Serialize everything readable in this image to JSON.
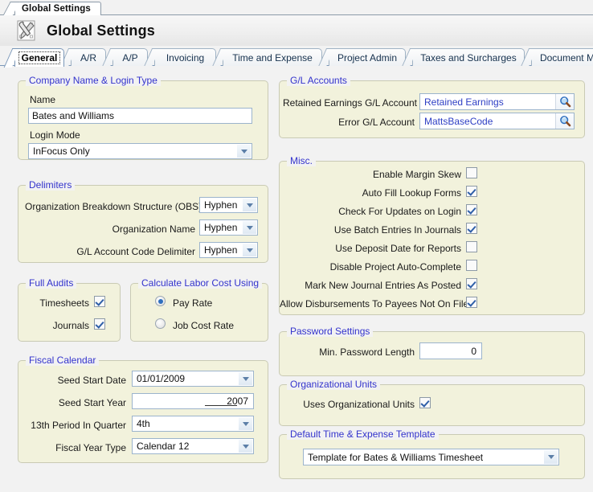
{
  "window": {
    "tab_label": "Global Settings"
  },
  "header": {
    "title": "Global Settings",
    "icon": "wrench-screwdriver-icon"
  },
  "tabs": [
    {
      "label": "General",
      "selected": true
    },
    {
      "label": "A/R",
      "selected": false
    },
    {
      "label": "A/P",
      "selected": false
    },
    {
      "label": "Invoicing",
      "selected": false
    },
    {
      "label": "Time and Expense",
      "selected": false
    },
    {
      "label": "Project Admin",
      "selected": false
    },
    {
      "label": "Taxes and Surcharges",
      "selected": false
    },
    {
      "label": "Document Management",
      "selected": false
    }
  ],
  "company_panel": {
    "legend": "Company Name & Login Type",
    "name_label": "Name",
    "name_value": "Bates and Williams",
    "login_mode_label": "Login Mode",
    "login_mode_value": "InFocus Only"
  },
  "delimiters_panel": {
    "legend": "Delimiters",
    "rows": [
      {
        "label": "Organization Breakdown Structure (OBS)",
        "value": "Hyphen"
      },
      {
        "label": "Organization Name",
        "value": "Hyphen"
      },
      {
        "label": "G/L Account Code Delimiter",
        "value": "Hyphen"
      }
    ]
  },
  "full_audits_panel": {
    "legend": "Full Audits",
    "rows": [
      {
        "label": "Timesheets",
        "checked": true
      },
      {
        "label": "Journals",
        "checked": true
      }
    ]
  },
  "labor_cost_panel": {
    "legend": "Calculate Labor Cost Using",
    "options": [
      {
        "label": "Pay Rate",
        "selected": true
      },
      {
        "label": "Job Cost Rate",
        "selected": false
      }
    ]
  },
  "fiscal_panel": {
    "legend": "Fiscal Calendar",
    "seed_start_date_label": "Seed Start Date",
    "seed_start_date_value": "01/01/2009",
    "seed_start_year_label": "Seed Start Year",
    "seed_start_year_value": "2007",
    "period13_label": "13th Period In Quarter",
    "period13_value": "4th",
    "fiscal_year_type_label": "Fiscal Year Type",
    "fiscal_year_type_value": "Calendar 12"
  },
  "gl_panel": {
    "legend": "G/L Accounts",
    "retained_label": "Retained Earnings G/L Account",
    "retained_value": "Retained Earnings",
    "error_label": "Error G/L Account",
    "error_value": "MattsBaseCode",
    "lookup_icon": "magnifier-icon"
  },
  "misc_panel": {
    "legend": "Misc.",
    "rows": [
      {
        "label": "Enable Margin Skew",
        "checked": false
      },
      {
        "label": "Auto Fill Lookup Forms",
        "checked": true
      },
      {
        "label": "Check For Updates on Login",
        "checked": true
      },
      {
        "label": "Use Batch Entries In Journals",
        "checked": true
      },
      {
        "label": "Use Deposit Date for Reports",
        "checked": false
      },
      {
        "label": "Disable Project Auto-Complete",
        "checked": false
      },
      {
        "label": "Mark New Journal Entries As Posted",
        "checked": true
      },
      {
        "label": "Allow Disbursements To Payees Not On File",
        "checked": true
      }
    ]
  },
  "password_panel": {
    "legend": "Password Settings",
    "min_length_label": "Min. Password Length",
    "min_length_value": "0"
  },
  "org_units_panel": {
    "legend": "Organizational Units",
    "uses_label": "Uses Organizational Units",
    "uses_checked": true
  },
  "template_panel": {
    "legend": "Default Time & Expense Template",
    "value": "Template for Bates & Williams Timesheet"
  },
  "colors": {
    "panel_background": "#f2f2dc",
    "panel_border": "#c9cab4",
    "legend_text": "#3333cc",
    "page_background": "#f2f2f2",
    "field_border": "#9cb4cc",
    "link_value_text": "#2d3ec4"
  }
}
